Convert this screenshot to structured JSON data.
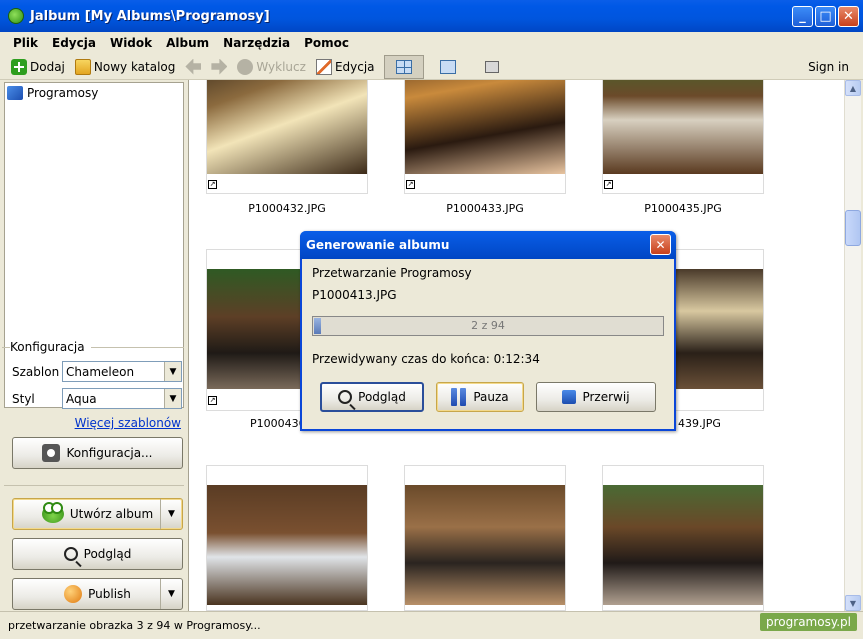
{
  "window": {
    "title": "Jalbum [My Albums\\Programosy]",
    "minimize": "_",
    "maximize": "□",
    "close": "✕"
  },
  "menu": [
    "Plik",
    "Edycja",
    "Widok",
    "Album",
    "Narzędzia",
    "Pomoc"
  ],
  "toolbar": {
    "add": "Dodaj",
    "new_folder": "Nowy katalog",
    "exclude": "Wyklucz",
    "edit": "Edycja",
    "sign_in": "Sign in"
  },
  "tree": {
    "root": "Programosy"
  },
  "config": {
    "section": "Konfiguracja",
    "template_label": "Szablon",
    "template_value": "Chameleon",
    "style_label": "Styl",
    "style_value": "Aqua",
    "more_templates": "Więcej szablonów",
    "config_button": "Konfiguracja...",
    "create_album": "Utwórz album",
    "preview": "Podgląd",
    "publish": "Publish"
  },
  "thumbnails": [
    {
      "caption": "P1000432.JPG"
    },
    {
      "caption": "P1000433.JPG"
    },
    {
      "caption": "P1000435.JPG"
    },
    {
      "caption": "P1000436"
    },
    {
      "caption": "439.JPG"
    },
    {
      "caption": ""
    },
    {
      "caption": ""
    },
    {
      "caption": ""
    }
  ],
  "dialog": {
    "title": "Generowanie albumu",
    "processing": "Przetwarzanie Programosy",
    "file": "P1000413.JPG",
    "progress_text": "2 z 94",
    "progress_fraction": 0.021,
    "eta": "Przewidywany czas do końca: 0:12:34",
    "preview": "Podgląd",
    "pause": "Pauza",
    "abort": "Przerwij",
    "close": "✕"
  },
  "status": {
    "text": "przetwarzanie obrazka 3 z 94 w Programosy..."
  },
  "watermark": {
    "badge": "programosy.pl",
    "background": "programosy.pl"
  }
}
